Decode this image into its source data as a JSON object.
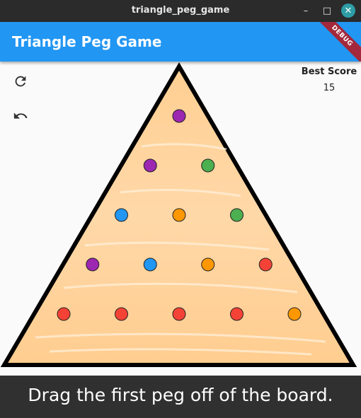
{
  "window": {
    "title": "triangle_peg_game"
  },
  "app": {
    "title": "Triangle Peg Game",
    "debug_banner": "DEBUG"
  },
  "controls": {
    "restart_icon": "restart-icon",
    "undo_icon": "undo-icon"
  },
  "best_score": {
    "label": "Best Score",
    "value": "15"
  },
  "board": {
    "rows": [
      [
        "purple"
      ],
      [
        "purple",
        "green"
      ],
      [
        "blue",
        "orange",
        "green"
      ],
      [
        "purple",
        "blue",
        "orange",
        "red"
      ],
      [
        "red",
        "red",
        "red",
        "red",
        "orange"
      ]
    ],
    "peg_colors": {
      "purple": "#9c27b0",
      "green": "#4caf50",
      "blue": "#2196f3",
      "orange": "#ff9800",
      "red": "#f44336"
    }
  },
  "status": {
    "message": "Drag the first peg off of the board."
  },
  "colors": {
    "app_bar": "#2196f3",
    "board_fill": "#ffd39a",
    "status_bar": "#303030"
  }
}
